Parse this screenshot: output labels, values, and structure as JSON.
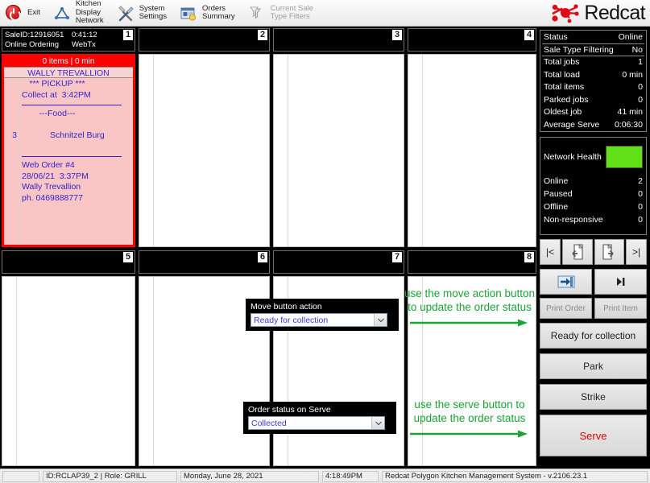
{
  "toolbar": {
    "items": [
      {
        "label": "Exit",
        "icon": "power-icon",
        "disabled": false
      },
      {
        "label": "Kitchen\nDisplay\nNetwork",
        "icon": "network-triangle-icon",
        "disabled": false
      },
      {
        "label": "System\nSettings",
        "icon": "tools-icon",
        "disabled": false
      },
      {
        "label": "Orders\nSummary",
        "icon": "orders-summary-icon",
        "disabled": false
      },
      {
        "label": "Current Sale\nType Filters",
        "icon": "filter-icon",
        "disabled": true
      }
    ],
    "brand": "Redcat"
  },
  "tiles": [
    {
      "num": "1",
      "active": true,
      "head": {
        "l1": "SaleID:12916051",
        "l2": "Online Ordering",
        "c1": "0:41:12",
        "c2": "WebTx"
      },
      "order": {
        "status_bar": "0 items |   0 min",
        "customer_name": "WALLY TREVALLION",
        "type_line": "*** PICKUP ***",
        "collect_line": "Collect at  3:42PM",
        "section_label": "---Food---",
        "items": [
          {
            "qty": "3",
            "name": "Schnitzel Burg"
          }
        ],
        "footer": [
          "Web Order #4",
          "28/06/21  3:37PM",
          "Wally Trevallion",
          "ph. 0469888777"
        ]
      }
    },
    {
      "num": "2",
      "active": false,
      "head": {
        "l1": "",
        "l2": "",
        "c1": "",
        "c2": ""
      }
    },
    {
      "num": "3",
      "active": false,
      "head": {
        "l1": "",
        "l2": "",
        "c1": "",
        "c2": ""
      }
    },
    {
      "num": "4",
      "active": false,
      "head": {
        "l1": "",
        "l2": "",
        "c1": "",
        "c2": ""
      }
    },
    {
      "num": "5",
      "active": false,
      "head": {
        "l1": "",
        "l2": "",
        "c1": "",
        "c2": ""
      }
    },
    {
      "num": "6",
      "active": false,
      "head": {
        "l1": "",
        "l2": "",
        "c1": "",
        "c2": ""
      }
    },
    {
      "num": "7",
      "active": false,
      "head": {
        "l1": "",
        "l2": "",
        "c1": "",
        "c2": ""
      }
    },
    {
      "num": "8",
      "active": false,
      "head": {
        "l1": "",
        "l2": "",
        "c1": "",
        "c2": ""
      }
    }
  ],
  "stats": {
    "rows": [
      {
        "label": "Status",
        "value": "Online"
      },
      {
        "label": "Sale Type Filtering",
        "value": "No"
      },
      {
        "label": "Total jobs",
        "value": "1"
      },
      {
        "label": "Total load",
        "value": "0 min"
      },
      {
        "label": "Total items",
        "value": "0"
      },
      {
        "label": "Parked jobs",
        "value": "0"
      },
      {
        "label": "Oldest job",
        "value": "41 min"
      },
      {
        "label": "Average Serve",
        "value": "0:06:30"
      }
    ]
  },
  "network": {
    "title": "Network Health",
    "health_color": "#62e017",
    "rows": [
      {
        "label": "Online",
        "value": "2"
      },
      {
        "label": "Paused",
        "value": "0"
      },
      {
        "label": "Offline",
        "value": "0"
      },
      {
        "label": "Non-responsive",
        "value": "0"
      }
    ]
  },
  "buttons": {
    "nav_first": "|<",
    "nav_prev": "prev-page-icon",
    "nav_next": "next-page-icon",
    "nav_last": ">|",
    "move": "move-right-icon",
    "skip": "skip-icon",
    "print_order": "Print Order",
    "print_item": "Print Item",
    "ready": "Ready for collection",
    "park": "Park",
    "strike": "Strike",
    "serve": "Serve"
  },
  "callouts": {
    "move_action": {
      "title": "Move button action",
      "value": "Ready for collection"
    },
    "serve_status": {
      "title": "Order status on Serve",
      "value": "Collected"
    }
  },
  "notes": {
    "move": "use the move action button to update the order status",
    "serve": "use the serve button to update the order status"
  },
  "statusbar": {
    "cell1": "",
    "cell2": "ID:RCLAP39_2 | Role: GRILL",
    "cell3": "Monday, June 28, 2021",
    "cell4": "4:18:49PM",
    "cell5": "Redcat Polygon Kitchen Management System - v.2106.23.1"
  }
}
